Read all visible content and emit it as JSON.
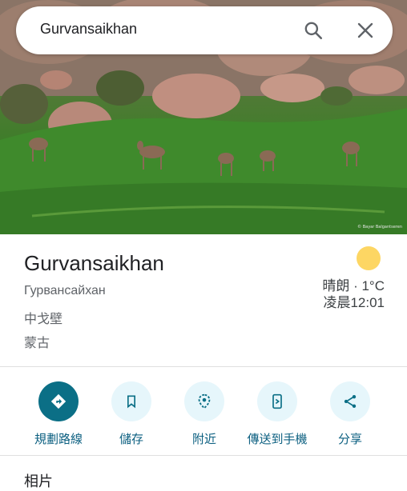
{
  "search": {
    "query": "Gurvansaikhan"
  },
  "photo": {
    "credit": "© Bayar Balgantseren"
  },
  "place": {
    "name": "Gurvansaikhan",
    "lines": [
      "Гурвансайхан",
      "中戈壁",
      "蒙古"
    ]
  },
  "weather": {
    "condition": "晴朗 · 1°C",
    "time": "凌晨12:01"
  },
  "actions": [
    {
      "label": "規劃路線",
      "icon": "directions-icon"
    },
    {
      "label": "儲存",
      "icon": "bookmark-icon"
    },
    {
      "label": "附近",
      "icon": "nearby-icon"
    },
    {
      "label": "傳送到手機",
      "icon": "send-to-phone-icon"
    },
    {
      "label": "分享",
      "icon": "share-icon"
    }
  ],
  "colors": {
    "accent": "#0b6f86",
    "action_bg": "#e6f6fb",
    "label": "#0b5f80",
    "sun": "#fdd663"
  },
  "next_section": {
    "label": "相片"
  }
}
